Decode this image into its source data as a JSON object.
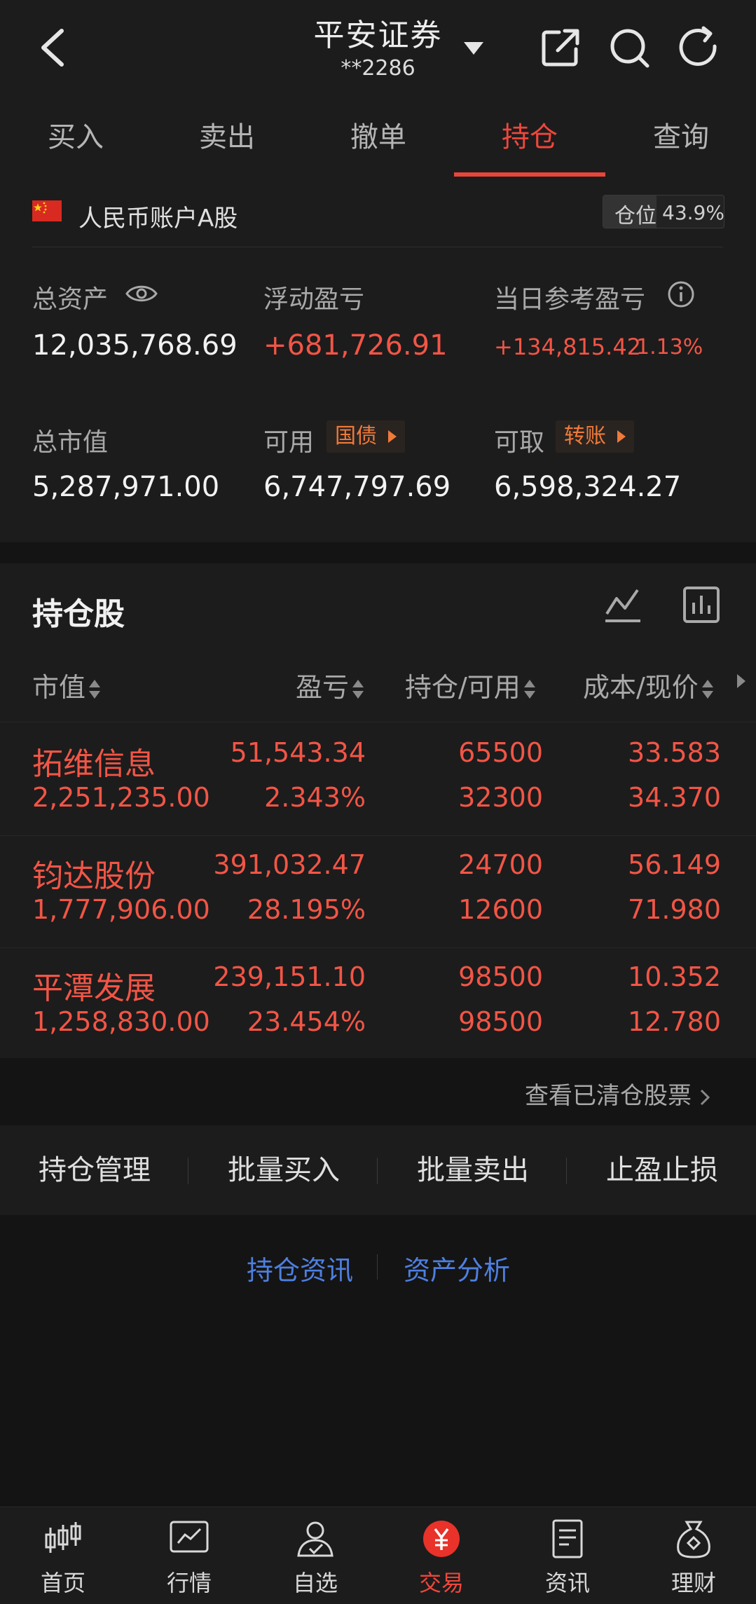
{
  "header": {
    "title": "平安证券",
    "account": "**2286"
  },
  "tabs": [
    "买入",
    "卖出",
    "撤单",
    "持仓",
    "查询"
  ],
  "account": {
    "label": "人民币账户A股",
    "position_ratio_label": "仓位",
    "position_ratio_value": "43.9%",
    "position_ratio_fraction": 0.439,
    "metrics": {
      "total_assets_label": "总资产",
      "total_assets": "12,035,768.69",
      "floating_pl_label": "浮动盈亏",
      "floating_pl": "+681,726.91",
      "daily_pl_label": "当日参考盈亏",
      "daily_pl": "+134,815.42",
      "daily_pl_pct": "1.13%",
      "market_value_label": "总市值",
      "market_value": "5,287,971.00",
      "available_label": "可用",
      "available_tag": "国债",
      "available": "6,747,797.69",
      "withdrawable_label": "可取",
      "withdrawable_tag": "转账",
      "withdrawable": "6,598,324.27"
    }
  },
  "holdings": {
    "title": "持仓股",
    "columns": [
      "市值",
      "盈亏",
      "持仓/可用",
      "成本/现价"
    ],
    "rows": [
      {
        "name": "拓维信息",
        "market_value": "2,251,235.00",
        "pl": "51,543.34",
        "pl_pct": "2.343%",
        "position": "65500",
        "available": "32300",
        "cost": "33.583",
        "price": "34.370"
      },
      {
        "name": "钧达股份",
        "market_value": "1,777,906.00",
        "pl": "391,032.47",
        "pl_pct": "28.195%",
        "position": "24700",
        "available": "12600",
        "cost": "56.149",
        "price": "71.980"
      },
      {
        "name": "平潭发展",
        "market_value": "1,258,830.00",
        "pl": "239,151.10",
        "pl_pct": "23.454%",
        "position": "98500",
        "available": "98500",
        "cost": "10.352",
        "price": "12.780"
      }
    ],
    "view_cleared": "查看已清仓股票"
  },
  "actions": [
    "持仓管理",
    "批量买入",
    "批量卖出",
    "止盈止损"
  ],
  "links": {
    "news": "持仓资讯",
    "analysis": "资产分析"
  },
  "nav": [
    "首页",
    "行情",
    "自选",
    "交易",
    "资讯",
    "理财"
  ],
  "colors": {
    "accent": "#f0463c",
    "profit": "#f25546",
    "link": "#4e7fe0",
    "tag": "#f07a3a"
  }
}
